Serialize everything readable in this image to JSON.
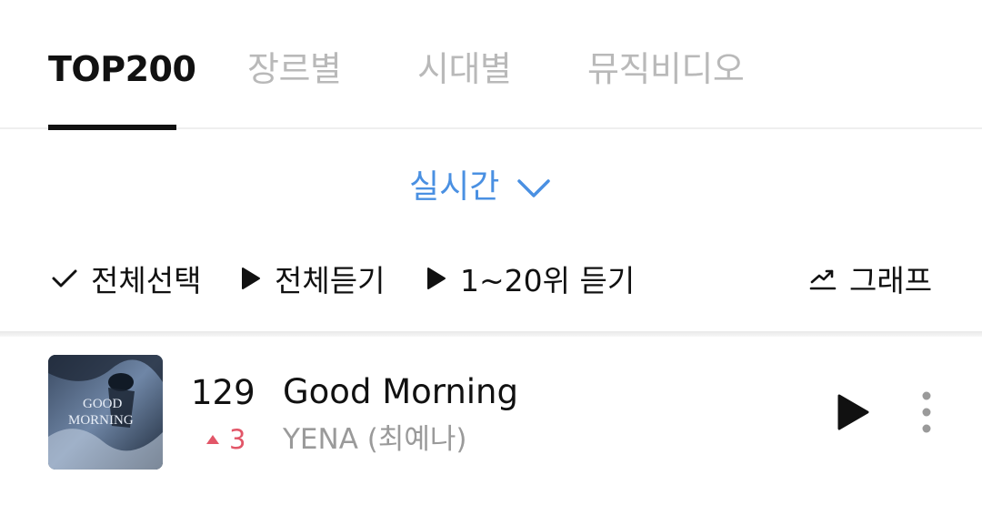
{
  "tabs": [
    {
      "label": "TOP200",
      "active": true
    },
    {
      "label": "장르별",
      "active": false
    },
    {
      "label": "시대별",
      "active": false
    },
    {
      "label": "뮤직비디오",
      "active": false
    }
  ],
  "period": {
    "label": "실시간",
    "icon": "chevron-down-icon"
  },
  "actions": {
    "select_all": "전체선택",
    "listen_all": "전체듣기",
    "listen_top": "1~20위 듣기",
    "graph": "그래프"
  },
  "track": {
    "rank": "129",
    "change": "3",
    "change_direction": "up",
    "title": "Good Morning",
    "artist": "YENA (최예나)",
    "cover_text_line1": "GOOD",
    "cover_text_line2": "MORNING"
  },
  "colors": {
    "accent": "#4a90e2",
    "rank_up": "#e25668",
    "inactive_tab": "#b9b9b9",
    "artist": "#9a9a9a"
  }
}
